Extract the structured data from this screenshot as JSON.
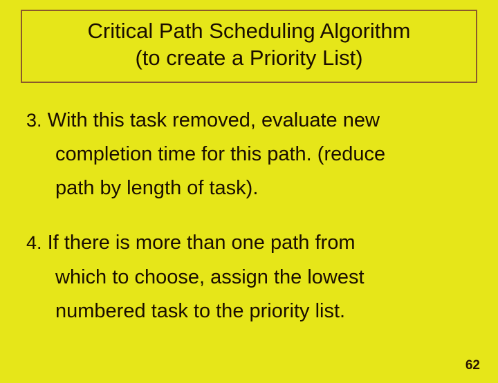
{
  "title": {
    "line1": "Critical Path Scheduling Algorithm",
    "line2": "(to create a Priority List)"
  },
  "items": [
    {
      "num": "3.",
      "first": "With this task removed, evaluate new",
      "rest1": "completion time for this path. (reduce",
      "rest2": "path by length of task)."
    },
    {
      "num": "4.",
      "first": "If there is more than one path from",
      "rest1": "which to choose, assign the lowest",
      "rest2": "numbered task to the priority list."
    }
  ],
  "page_number": "62"
}
